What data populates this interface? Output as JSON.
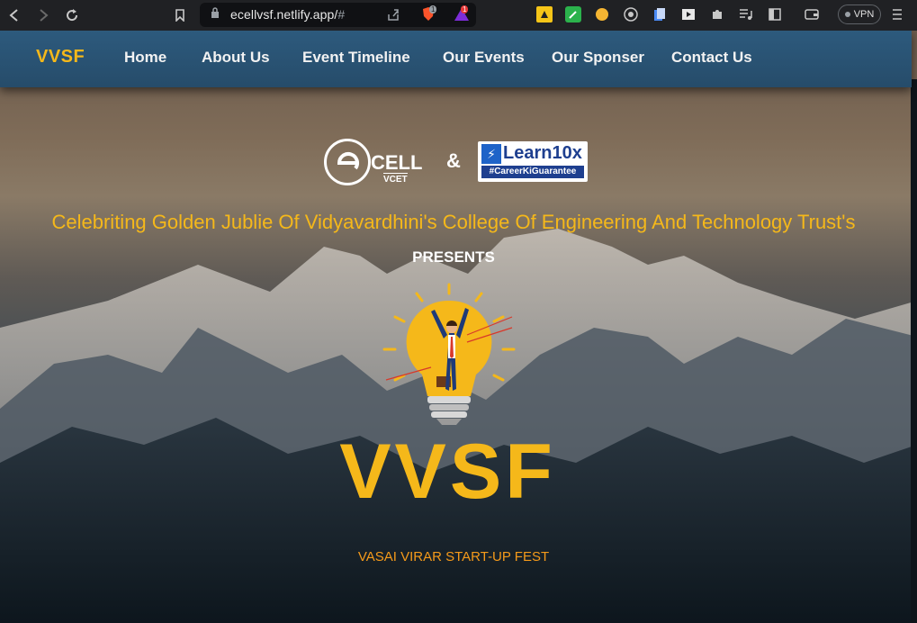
{
  "browser": {
    "url_main": "ecellvsf.netlify.app/",
    "url_hash": "#",
    "vpn_label": "VPN",
    "brave_badge": "1",
    "rewards_badge": "1"
  },
  "navbar": {
    "brand": "VVSF",
    "links": [
      "Home",
      "About Us",
      "Event Timeline",
      "Our Events",
      "Our Sponser",
      "Contact Us"
    ]
  },
  "hero": {
    "ecell_text": "CELL",
    "ecell_sub": "VCET",
    "amp": "&",
    "learn_name": "Learn10x",
    "learn_tag": "#CareerKiGuarantee",
    "subtitle": "Celebriting Golden Jublie Of Vidyavardhini's College Of Engineering And Technology Trust's",
    "presents": "PRESENTS",
    "big_title": "VVSF",
    "tagline": "VASAI VIRAR START-UP FEST"
  },
  "colors": {
    "accent": "#f5b81a",
    "navbar": "#2d5a7d",
    "tagline": "#f59a1a"
  }
}
